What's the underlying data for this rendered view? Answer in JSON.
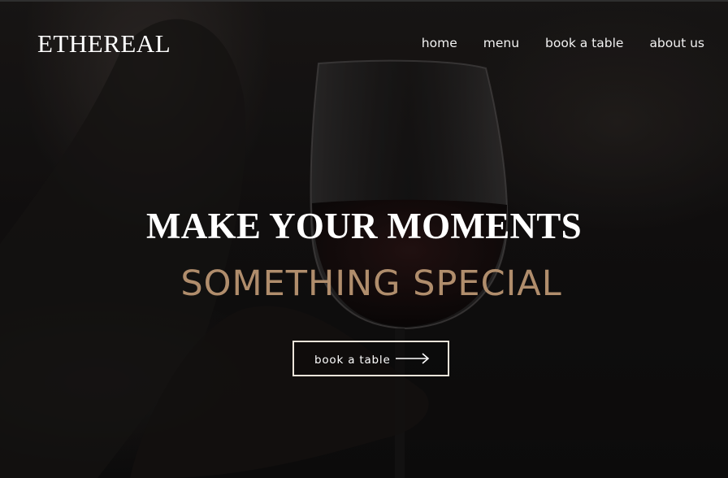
{
  "brand": {
    "logo_text": "ETHEREAL"
  },
  "nav": {
    "items": [
      {
        "label": "home"
      },
      {
        "label": "menu"
      },
      {
        "label": "book a table"
      },
      {
        "label": "about us"
      }
    ]
  },
  "hero": {
    "headline": "MAKE YOUR MOMENTS",
    "subheadline": "SOMETHING SPECIAL",
    "accent_color": "#b08d6c",
    "background_image": "wine-glass-photo",
    "cta": {
      "label": "book a table",
      "icon": "arrow-right-icon"
    }
  }
}
